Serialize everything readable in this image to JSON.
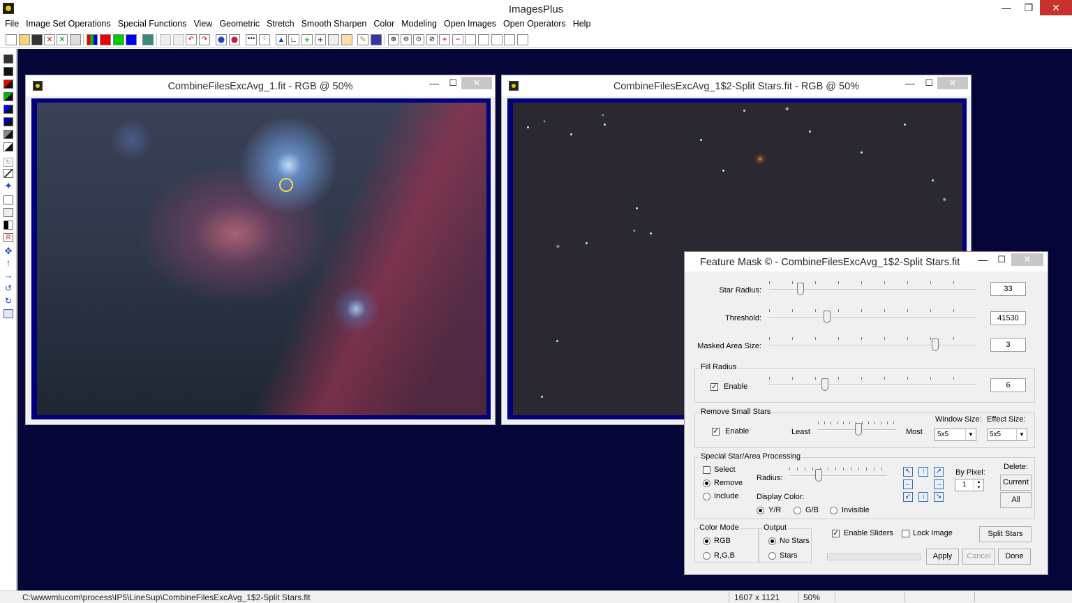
{
  "app": {
    "title": "ImagesPlus",
    "controls": {
      "minimize": "—",
      "maximize": "❐",
      "close": "✕"
    }
  },
  "menu": [
    "File",
    "Image Set Operations",
    "Special Functions",
    "View",
    "Geometric",
    "Stretch",
    "Smooth Sharpen",
    "Color",
    "Modeling",
    "Open Images",
    "Open Operators",
    "Help"
  ],
  "windows": [
    {
      "title": "CombineFilesExcAvg_1.fit - RGB @ 50%",
      "controls": {
        "minimize": "—",
        "maximize": "☐",
        "close": "✕"
      }
    },
    {
      "title": "CombineFilesExcAvg_1$2-Split Stars.fit - RGB @ 50%",
      "controls": {
        "minimize": "—",
        "maximize": "☐",
        "close": "✕"
      }
    }
  ],
  "dialog": {
    "title": "Feature Mask © - CombineFilesExcAvg_1$2-Split Stars.fit",
    "controls": {
      "minimize": "—",
      "maximize": "☐",
      "close": "✕"
    },
    "star_radius": {
      "label": "Star Radius:",
      "value": "33",
      "position": 0.15
    },
    "threshold": {
      "label": "Threshold:",
      "value": "41530",
      "position": 0.28
    },
    "masked_area": {
      "label": "Masked Area Size:",
      "value": "3",
      "position": 0.8
    },
    "fill_radius": {
      "group": "Fill Radius",
      "enable": "Enable",
      "value": "6",
      "position": 0.27,
      "checked": true
    },
    "remove_small": {
      "group": "Remove Small Stars",
      "enable": "Enable",
      "checked": true,
      "least": "Least",
      "most": "Most",
      "position": 0.52,
      "window_size_label": "Window Size:",
      "window_size": "5x5",
      "effect_size_label": "Effect Size:",
      "effect_size": "5x5"
    },
    "special": {
      "group": "Special Star/Area Processing",
      "select": "Select",
      "remove": "Remove",
      "include": "Include",
      "radius": "Radius:",
      "radius_position": 0.3,
      "display_color": "Display Color:",
      "yr": "Y/R",
      "gb": "G/B",
      "invisible": "Invisible",
      "by_pixel": "By Pixel:",
      "by_pixel_value": "1",
      "delete": "Delete:",
      "current": "Current",
      "all": "All",
      "arrows": [
        "↖",
        "↑",
        "↗",
        "←",
        "→",
        "↙",
        "↓",
        "↘"
      ]
    },
    "color_mode": {
      "group": "Color Mode",
      "rgb": "RGB",
      "r_g_b": "R,G,B"
    },
    "output": {
      "group": "Output",
      "no_stars": "No Stars",
      "stars": "Stars"
    },
    "enable_sliders": "Enable Sliders",
    "lock_image": "Lock Image",
    "buttons": {
      "split_stars": "Split Stars",
      "apply": "Apply",
      "cancel": "Cancel",
      "done": "Done"
    }
  },
  "status": {
    "path": "C:\\wwwmlucom\\process\\IP5\\LineSup\\CombineFilesExcAvg_1$2-Split Stars.fit",
    "dimensions": "1607 x 1121",
    "zoom": "50%"
  },
  "colors": {
    "workspace": "#050538",
    "frame": "#00007a",
    "close_red": "#c7322b"
  }
}
